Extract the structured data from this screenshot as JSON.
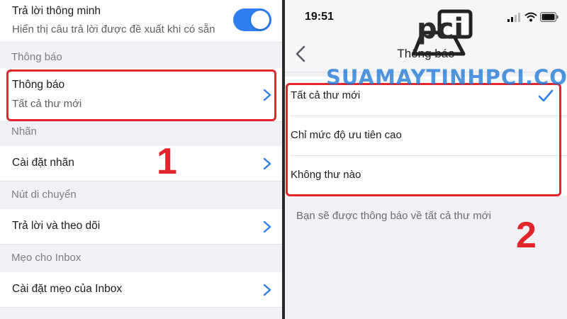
{
  "left": {
    "smart_reply": {
      "title": "Trả lời thông minh",
      "subtitle": "Hiển thị câu trả lời được đề xuất khi có sẵn",
      "enabled": true
    },
    "sections": [
      {
        "header": "Thông báo",
        "row_title": "Thông báo",
        "row_subtitle": "Tất cả thư mới"
      },
      {
        "header": "Nhãn",
        "row_title": "Cài đặt nhãn"
      },
      {
        "header": "Nút di chuyển",
        "row_title": "Trả lời và theo dõi"
      },
      {
        "header": "Mẹo cho Inbox",
        "row_title": "Cài đặt mẹo của Inbox"
      }
    ],
    "annotation_number": "1"
  },
  "right": {
    "status_time": "19:51",
    "nav_title": "Thông báo",
    "options": [
      {
        "label": "Tất cả thư mới",
        "selected": true
      },
      {
        "label": "Chỉ mức độ ưu tiên cao",
        "selected": false
      },
      {
        "label": "Không thư nào",
        "selected": false
      }
    ],
    "footer_note": "Bạn sẽ được thông báo về tất cả thư mới",
    "annotation_number": "2"
  },
  "watermark": "SUAMAYTINHPCI.COM",
  "logo_text": "pci",
  "colors": {
    "accent": "#2f7ff0",
    "annotation_red": "#e3262b",
    "watermark_blue": "#1f79d6"
  },
  "icons": [
    "chevron-right-icon",
    "back-chevron-icon",
    "checkmark-icon",
    "signal-icon",
    "wifi-icon",
    "battery-icon"
  ]
}
